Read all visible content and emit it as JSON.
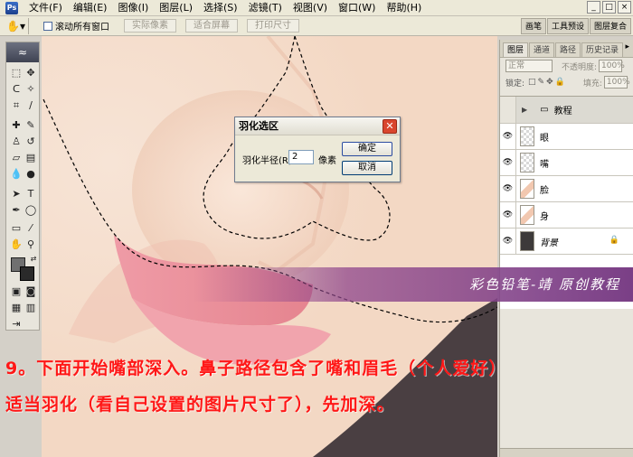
{
  "menu": {
    "items": [
      "文件(F)",
      "编辑(E)",
      "图像(I)",
      "图层(L)",
      "选择(S)",
      "滤镜(T)",
      "视图(V)",
      "窗口(W)",
      "帮助(H)"
    ]
  },
  "options_bar": {
    "checkbox_label": "滚动所有窗口",
    "buttons": [
      "实际像素",
      "适合屏幕",
      "打印尺寸"
    ],
    "palette_well_tabs": [
      "画笔",
      "工具预设",
      "图层复合"
    ]
  },
  "dialog": {
    "title": "羽化选区",
    "radius_label": "羽化半径(R):",
    "radius_value": "2",
    "unit": "像素",
    "ok_label": "确定",
    "cancel_label": "取消"
  },
  "layers_panel": {
    "tabs": [
      "图层",
      "通道",
      "路径",
      "历史记录"
    ],
    "blend_mode": "正常",
    "opacity_label": "不透明度:",
    "opacity_value": "100%",
    "lock_label": "锁定:",
    "fill_label": "填充:",
    "fill_value": "100%",
    "layers": [
      {
        "name": "教程",
        "type": "group"
      },
      {
        "name": "眼",
        "type": "layer"
      },
      {
        "name": "嘴",
        "type": "layer"
      },
      {
        "name": "脸",
        "type": "layer"
      },
      {
        "name": "身",
        "type": "layer"
      },
      {
        "name": "背景",
        "type": "background"
      }
    ]
  },
  "watermark": "彩色铅笔-靖  原创教程",
  "caption": {
    "line1": "9。下面开始嘴部深入。鼻子路径包含了嘴和眉毛（个人爱好）",
    "line2": "适当羽化（看自己设置的图片尺寸了），先加深。"
  },
  "colors": {
    "caption": "#ff1717",
    "watermark_band": "#7a3f86",
    "skin": "#f3dccb",
    "lips": "#e9909a",
    "dark_bg": "#4a3f42"
  }
}
